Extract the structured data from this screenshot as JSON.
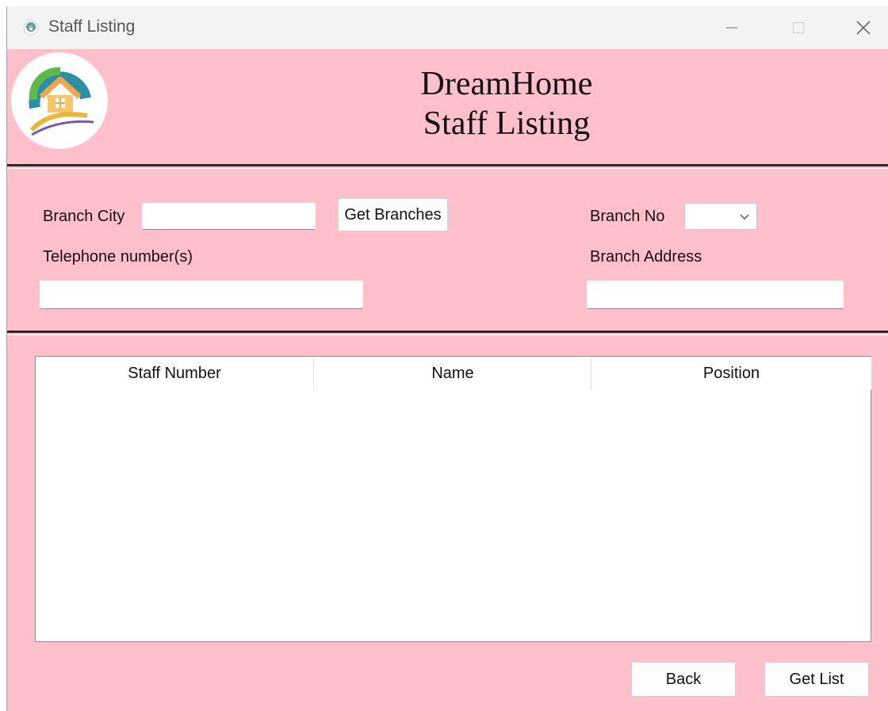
{
  "window": {
    "title": "Staff Listing",
    "icon": "app-house-icon",
    "controls": [
      "minimize-icon",
      "maximize-icon",
      "close-icon"
    ]
  },
  "header": {
    "logo_icon": "dreamhome-logo",
    "title_line1": "DreamHome",
    "title_line2": "Staff Listing"
  },
  "branch": {
    "city_label": "Branch City",
    "city_value": "",
    "get_branches_label": "Get Branches",
    "branch_no_label": "Branch No",
    "branch_no_value": "",
    "telephone_label": "Telephone number(s)",
    "telephone_value": "",
    "address_label": "Branch Address",
    "address_value": ""
  },
  "staff_table": {
    "columns": [
      "Staff Number",
      "Name",
      "Position"
    ],
    "rows": []
  },
  "footer": {
    "back_label": "Back",
    "get_list_label": "Get List"
  },
  "colors": {
    "background": "#ffc0cb",
    "titlebar": "#f3f3f3"
  }
}
